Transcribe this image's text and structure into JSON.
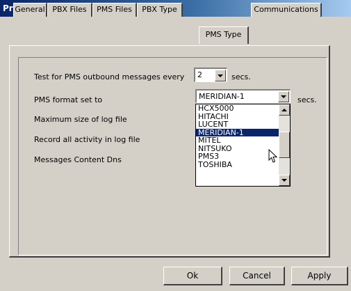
{
  "window": {
    "title": "Properties"
  },
  "tabs": [
    {
      "label": "General"
    },
    {
      "label": "PBX Files"
    },
    {
      "label": "PMS Files"
    },
    {
      "label": "PBX Type"
    },
    {
      "label": "PMS Type"
    },
    {
      "label": "Communications"
    }
  ],
  "form": {
    "test_label": "Test for PMS outbound messages every",
    "test_value": "2",
    "test_unit": "secs.",
    "format_label": "PMS format set to",
    "format_value": "MERIDIAN-1",
    "format_unit": "secs.",
    "log_size_label": "Maximum size of log file",
    "record_label": "Record all activity in log file",
    "messages_label": "Messages Content Dns"
  },
  "dropdown": {
    "options": [
      "HCX5000",
      "HITACHI",
      "LUCENT",
      "MERIDIAN-1",
      "MITEL",
      "NITSUKO",
      "PMS3",
      "TOSHIBA"
    ],
    "selected": "MERIDIAN-1"
  },
  "buttons": {
    "ok": "Ok",
    "cancel": "Cancel",
    "apply": "Apply"
  }
}
